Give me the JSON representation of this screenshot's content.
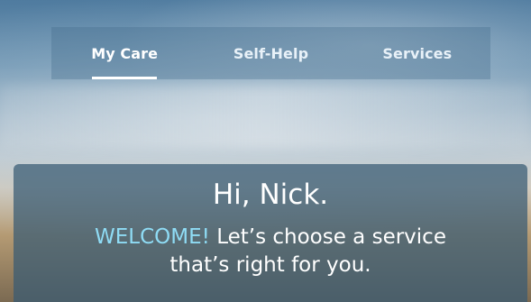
{
  "nav": {
    "tabs": [
      {
        "label": "My Care",
        "active": true
      },
      {
        "label": "Self-Help",
        "active": false
      },
      {
        "label": "Services",
        "active": false
      }
    ]
  },
  "welcome": {
    "greeting": "Hi, Nick.",
    "highlight": "WELCOME!",
    "message_line1": "Let’s choose a service",
    "message_line2": "that’s right for you."
  },
  "colors": {
    "accent": "#8fdcf5",
    "card_bg": "#375a73",
    "nav_bg": "#466e8c"
  }
}
